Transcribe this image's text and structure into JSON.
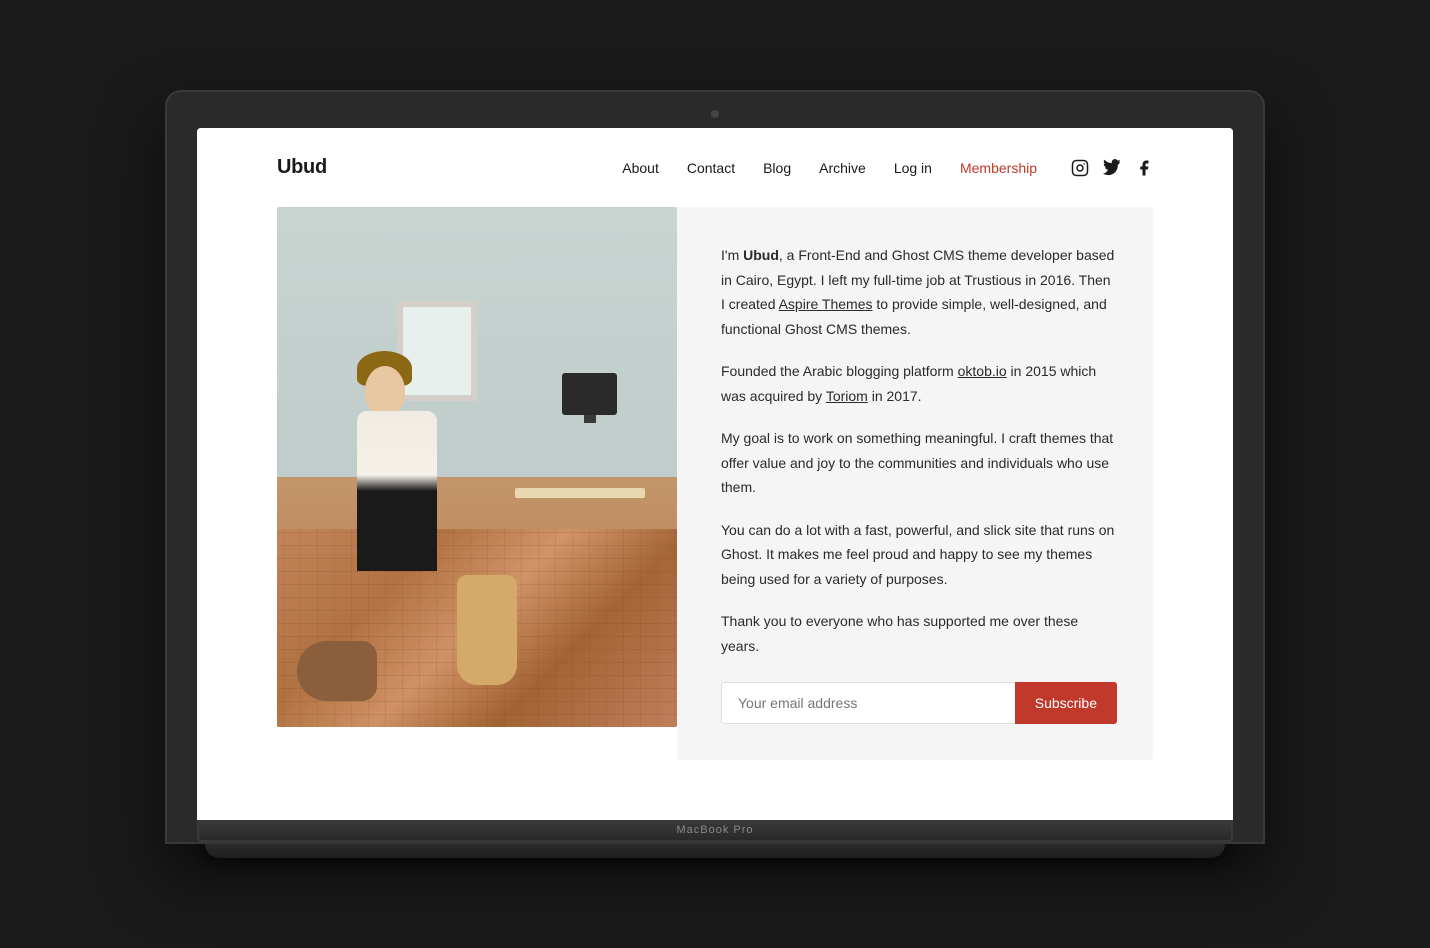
{
  "laptop": {
    "model_label": "MacBook Pro"
  },
  "site": {
    "logo": "Ubud",
    "nav": {
      "about": "About",
      "contact": "Contact",
      "blog": "Blog",
      "archive": "Archive",
      "login": "Log in",
      "membership": "Membership"
    },
    "icons": {
      "instagram": "instagram-icon",
      "twitter": "twitter-icon",
      "facebook": "facebook-icon"
    }
  },
  "about": {
    "paragraph1_intro": "I'm ",
    "paragraph1_bold": "Ubud",
    "paragraph1_rest": ", a Front-End and Ghost CMS theme developer based in Cairo, Egypt. I left my full-time job at Trustious in 2016. Then I created ",
    "paragraph1_link": "Aspire Themes",
    "paragraph1_end": " to provide simple, well-designed, and functional Ghost CMS themes.",
    "paragraph2_start": "Founded the Arabic blogging platform ",
    "paragraph2_link1": "oktob.io",
    "paragraph2_mid": " in 2015 which was acquired by ",
    "paragraph2_link2": "Toriom",
    "paragraph2_end": " in 2017.",
    "paragraph3": "My goal is to work on something meaningful. I craft themes that offer value and joy to the communities and individuals who use them.",
    "paragraph4": "You can do a lot with a fast, powerful, and slick site that runs on Ghost. It makes me feel proud and happy to see my themes being used for a variety of purposes.",
    "paragraph5": "Thank you to everyone who has supported me over these years.",
    "email_placeholder": "Your email address",
    "subscribe_label": "Subscribe"
  }
}
